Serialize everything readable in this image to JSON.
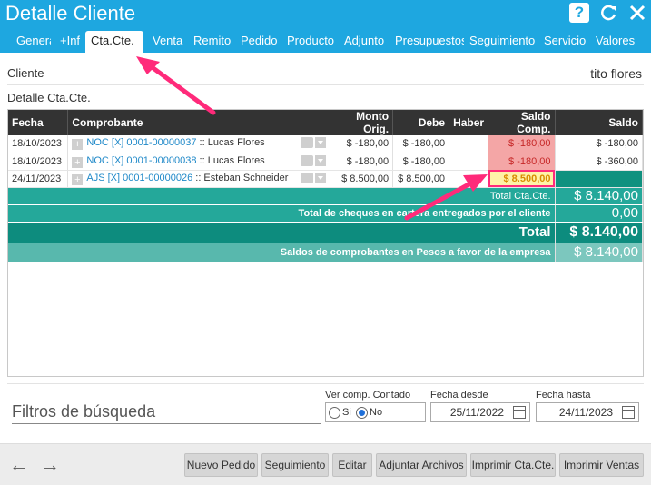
{
  "header": {
    "title": "Detalle Cliente",
    "tabs": [
      "Genera",
      "+Inf",
      "Cta.Cte.",
      "Venta",
      "Remito",
      "Pedido",
      "Producto",
      "Adjunto",
      "Presupuestos",
      "Seguimiento",
      "Servicio",
      "Valores"
    ],
    "active_tab": "Cta.Cte."
  },
  "cliente": {
    "label": "Cliente",
    "value": "tito flores"
  },
  "section_label": "Detalle Cta.Cte.",
  "table": {
    "headers": [
      "Fecha",
      "Comprobante",
      "Monto Orig.",
      "Debe",
      "Haber",
      "Saldo Comp.",
      "Saldo"
    ],
    "rows": [
      {
        "fecha": "18/10/2023",
        "comp_link": "NOC [X] 0001-00000037",
        "comp_name": ":: Lucas Flores",
        "monto": "$ -180,00",
        "debe": "$ -180,00",
        "haber": "",
        "saldo_comp": "$ -180,00",
        "saldo": "$ -180,00"
      },
      {
        "fecha": "18/10/2023",
        "comp_link": "NOC [X] 0001-00000038",
        "comp_name": ":: Lucas Flores",
        "monto": "$ -180,00",
        "debe": "$ -180,00",
        "haber": "",
        "saldo_comp": "$ -180,00",
        "saldo": "$ -360,00"
      },
      {
        "fecha": "24/11/2023",
        "comp_link": "AJS [X] 0001-00000026",
        "comp_name": ":: Esteban Schneider",
        "monto": "$ 8.500,00",
        "debe": "$ 8.500,00",
        "haber": "",
        "saldo_comp": "$ 8.500,00",
        "saldo": ""
      }
    ],
    "totals": {
      "total_ctacte_label": "Total Cta.Cte.",
      "total_ctacte_value": "$ 8.140,00",
      "cheques_label": "Total de cheques en cartera entregados por el cliente",
      "cheques_value": "0,00",
      "total_label": "Total",
      "total_value": "$ 8.140,00",
      "saldos_label": "Saldos de comprobantes en Pesos a favor de la empresa",
      "saldos_value": "$ 8.140,00"
    }
  },
  "filters": {
    "title": "Filtros de búsqueda",
    "ver_comp_label": "Ver comp. Contado",
    "opt_si": "Si",
    "opt_no": "No",
    "selected": "No",
    "fecha_desde_label": "Fecha desde",
    "fecha_desde": "25/11/2022",
    "fecha_hasta_label": "Fecha hasta",
    "fecha_hasta": "24/11/2023"
  },
  "footer": {
    "buttons": [
      "Nuevo Pedido",
      "Seguimiento",
      "Editar",
      "Adjuntar Archivos",
      "Imprimir Cta.Cte.",
      "Imprimir Ventas"
    ]
  },
  "colors": {
    "header": "#1ea7e0",
    "teal": "#24a89a",
    "teal_dark": "#0d8c7e",
    "annotation": "#ff2a7a"
  }
}
